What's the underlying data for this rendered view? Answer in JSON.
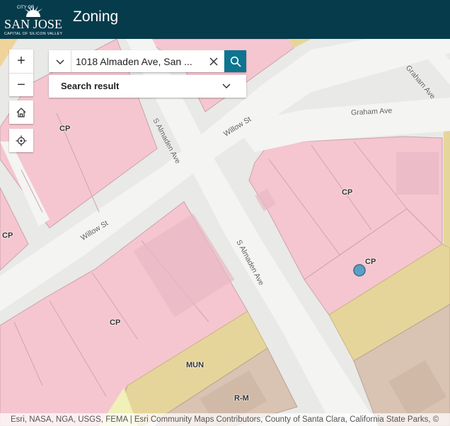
{
  "header": {
    "logo_text_top": "CITY OF",
    "logo_text_main": "SAN JOSE",
    "logo_text_sub": "CAPITAL OF SILICON VALLEY",
    "title": "Zoning"
  },
  "search": {
    "value": "1018 Almaden Ave, San ...",
    "source_icon": "chevron-down-icon",
    "clear_icon": "close-icon",
    "button_icon": "search-icon"
  },
  "search_result": {
    "label": "Search result",
    "icon": "chevron-down-icon"
  },
  "zoom": {
    "in": "+",
    "out": "−"
  },
  "widgets": {
    "home_icon": "home-icon",
    "locate_icon": "locate-icon"
  },
  "map": {
    "zones": [
      {
        "code": "CP"
      },
      {
        "code": "CP"
      },
      {
        "code": "CP"
      },
      {
        "code": "CP"
      },
      {
        "code": "CP"
      },
      {
        "code": "MUN"
      },
      {
        "code": "R-M"
      }
    ],
    "streets": [
      "Graham Ave",
      "Graham Ave",
      "Willow St",
      "Willow St",
      "S Almaden Ave",
      "S Almaden Ave"
    ],
    "colors": {
      "cp_zone": "#f5c6d0",
      "mun_zone": "#e6d59b",
      "rm_zone": "#d9c3b3",
      "road": "#f4f4f2",
      "header": "#063b4b",
      "search_button": "#0e7490",
      "marker": "#5aa0c4"
    }
  },
  "attribution": "Esri, NASA, NGA, USGS, FEMA | Esri Community Maps Contributors, County of Santa Clara, California State Parks, ©"
}
